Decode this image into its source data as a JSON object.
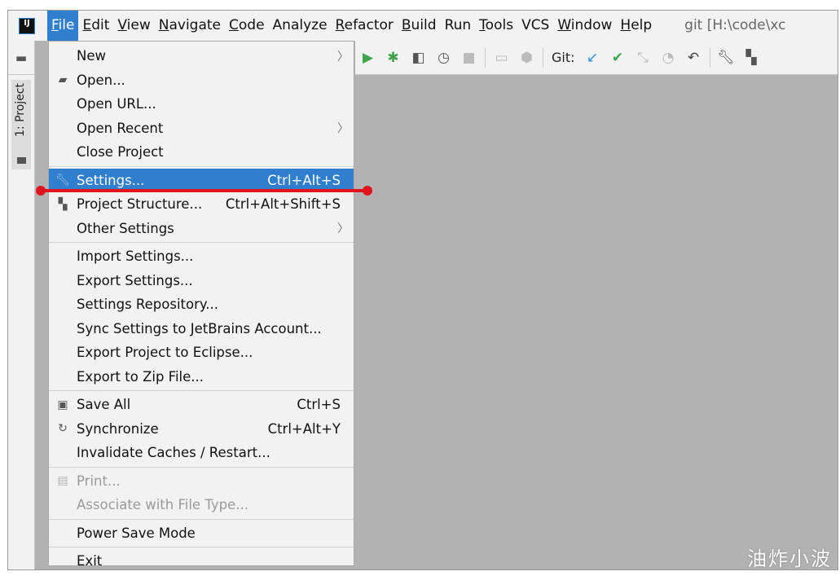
{
  "menubar": {
    "items": [
      "File",
      "Edit",
      "View",
      "Navigate",
      "Code",
      "Analyze",
      "Refactor",
      "Build",
      "Run",
      "Tools",
      "VCS",
      "Window",
      "Help"
    ],
    "title": "git [H:\\code\\xc"
  },
  "toolbar": {
    "git_label": "Git:",
    "icons": [
      "run",
      "debug",
      "coverage",
      "profile",
      "stop",
      "deploy",
      "build-artifact",
      "git-update",
      "git-commit",
      "git-compare",
      "git-history",
      "git-rollback",
      "settings-wrench",
      "project-structure"
    ]
  },
  "sidebar": {
    "project_tab": "1: Project"
  },
  "file_menu": {
    "items": [
      {
        "label": "New",
        "submenu": true
      },
      {
        "label": "Open...",
        "icon": "folder-open"
      },
      {
        "label": "Open URL..."
      },
      {
        "label": "Open Recent",
        "submenu": true
      },
      {
        "label": "Close Project"
      },
      {
        "sep": true
      },
      {
        "label": "Settings...",
        "shortcut": "Ctrl+Alt+S",
        "icon": "wrench",
        "selected": true
      },
      {
        "label": "Project Structure...",
        "shortcut": "Ctrl+Alt+Shift+S",
        "icon": "project-structure"
      },
      {
        "label": "Other Settings",
        "submenu": true
      },
      {
        "sep": true
      },
      {
        "label": "Import Settings..."
      },
      {
        "label": "Export Settings..."
      },
      {
        "label": "Settings Repository..."
      },
      {
        "label": "Sync Settings to JetBrains Account..."
      },
      {
        "label": "Export Project to Eclipse..."
      },
      {
        "label": "Export to Zip File..."
      },
      {
        "sep": true
      },
      {
        "label": "Save All",
        "shortcut": "Ctrl+S",
        "icon": "save"
      },
      {
        "label": "Synchronize",
        "shortcut": "Ctrl+Alt+Y",
        "icon": "sync"
      },
      {
        "label": "Invalidate Caches / Restart..."
      },
      {
        "sep": true
      },
      {
        "label": "Print...",
        "icon": "print",
        "disabled": true
      },
      {
        "label": "Associate with File Type...",
        "disabled": true
      },
      {
        "sep": true
      },
      {
        "label": "Power Save Mode"
      },
      {
        "sep": true
      },
      {
        "label": "Exit"
      }
    ]
  },
  "annotation": {
    "color": "#e0141c"
  },
  "watermark": "油炸小波",
  "colors": {
    "accent": "#2f7fce",
    "run": "#3fa34d",
    "git_update": "#2f8fe0"
  }
}
